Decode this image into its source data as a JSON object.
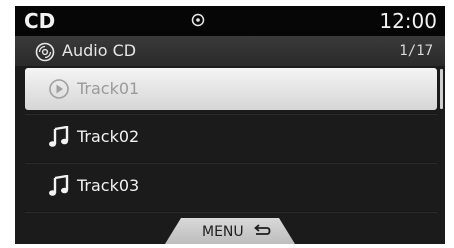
{
  "status_bar": {
    "source": "CD",
    "clock": "12:00",
    "disc_indicator_icon": "disc-indicator-icon"
  },
  "header": {
    "title": "Audio CD",
    "counter": "1/17",
    "icon": "cd-icon"
  },
  "tracks": [
    {
      "label": "Track01",
      "icon": "play-circle-icon",
      "selected": true
    },
    {
      "label": "Track02",
      "icon": "music-note-icon",
      "selected": false
    },
    {
      "label": "Track03",
      "icon": "music-note-icon",
      "selected": false
    }
  ],
  "menu": {
    "label": "MENU",
    "icon": "return-arrow-icon"
  },
  "colors": {
    "screen_bg": "#1b1b1b",
    "status_bg": "#060606",
    "selected_row": "#e8e8e8",
    "text": "#f2f2f2"
  }
}
